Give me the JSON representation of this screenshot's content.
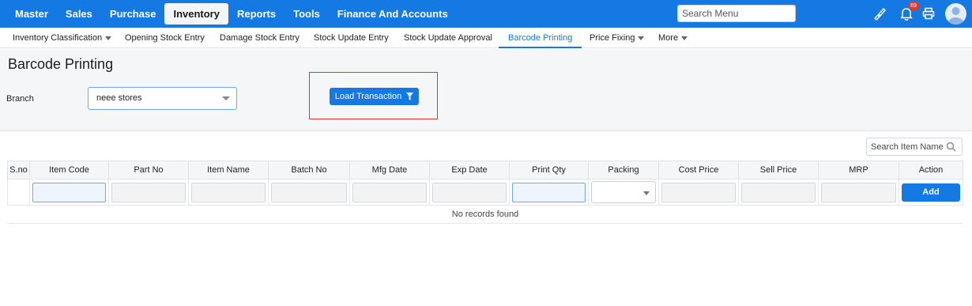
{
  "topnav": {
    "items": [
      "Master",
      "Sales",
      "Purchase",
      "Inventory",
      "Reports",
      "Tools",
      "Finance And Accounts"
    ],
    "active": "Inventory"
  },
  "search_menu": {
    "placeholder": "Search Menu"
  },
  "notifications": {
    "count": "69"
  },
  "icons": [
    "brush-icon",
    "bell-icon",
    "printer-icon",
    "user-avatar-icon"
  ],
  "subnav": {
    "items": [
      "Inventory Classification",
      "Opening Stock Entry",
      "Damage Stock Entry",
      "Stock Update Entry",
      "Stock Update Approval",
      "Barcode Printing",
      "Price Fixing",
      "More"
    ],
    "active": "Barcode Printing"
  },
  "page": {
    "title": "Barcode Printing",
    "branch_label": "Branch",
    "branch_value": "neee stores",
    "load_button": "Load Transaction"
  },
  "table": {
    "search_placeholder": "Search Item Name",
    "columns": [
      "S.no",
      "Item Code",
      "Part No",
      "Item Name",
      "Batch No",
      "Mfg Date",
      "Exp Date",
      "Print Qty",
      "Packing",
      "Cost Price",
      "Sell Price",
      "MRP",
      "Action"
    ],
    "add_button": "Add",
    "empty_message": "No records found"
  },
  "colors": {
    "primary": "#1479e3",
    "highlight": "#d9362b",
    "badge": "#e5372c"
  }
}
